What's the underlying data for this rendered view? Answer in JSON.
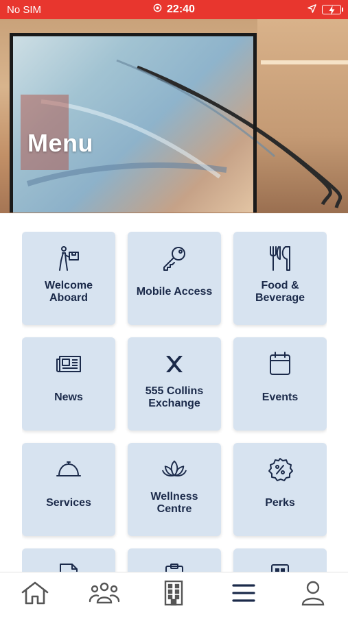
{
  "status_bar": {
    "carrier": "No SIM",
    "time": "22:40",
    "icons": [
      "alarm-icon",
      "location-arrow-icon",
      "battery-charging-icon"
    ]
  },
  "hero": {
    "title": "Menu"
  },
  "menu": {
    "items": [
      {
        "label": "Welcome Aboard",
        "icon": "delivery-person-icon"
      },
      {
        "label": "Mobile Access",
        "icon": "key-icon"
      },
      {
        "label": "Food & Beverage",
        "icon": "fork-knife-icon"
      },
      {
        "label": "News",
        "icon": "newspaper-icon"
      },
      {
        "label": "555 Collins Exchange",
        "icon": "exchange-logo-icon"
      },
      {
        "label": "Events",
        "icon": "calendar-icon"
      },
      {
        "label": "Services",
        "icon": "service-bell-icon"
      },
      {
        "label": "Wellness Centre",
        "icon": "lotus-icon"
      },
      {
        "label": "Perks",
        "icon": "discount-badge-icon"
      }
    ]
  },
  "tabbar": {
    "tabs": [
      {
        "icon": "home-icon"
      },
      {
        "icon": "community-icon"
      },
      {
        "icon": "building-icon"
      },
      {
        "icon": "menu-icon",
        "active": true
      },
      {
        "icon": "profile-icon"
      }
    ]
  },
  "colors": {
    "status_bar": "#e8362e",
    "tile_background": "#d7e3f0",
    "icon_navy": "#1b2a4a",
    "tab_icon": "#555555"
  }
}
